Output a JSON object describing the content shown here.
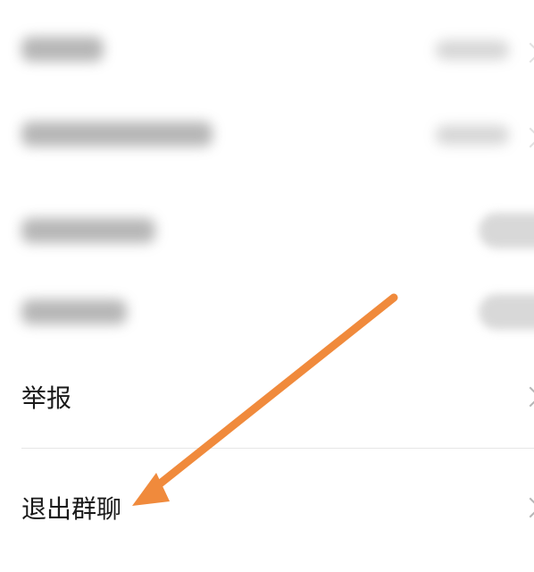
{
  "settings": {
    "rows": [
      {
        "label": "",
        "value": "",
        "control": "link",
        "obscured": true
      },
      {
        "label": "",
        "value": "",
        "control": "link",
        "obscured": true
      },
      {
        "label": "",
        "control": "toggle",
        "obscured": true
      },
      {
        "label": "",
        "control": "toggle",
        "obscured": true
      },
      {
        "label": "举报",
        "control": "chevron",
        "obscured": false
      },
      {
        "label": "退出群聊",
        "control": "chevron",
        "obscured": false
      }
    ]
  },
  "annotation": {
    "arrow_color": "#f08a3c",
    "points_to": "退出群聊"
  },
  "colors": {
    "background": "#ffffff",
    "text": "#1a1a1a",
    "divider": "#e6e6e6",
    "chevron": "#b6b6b6"
  }
}
